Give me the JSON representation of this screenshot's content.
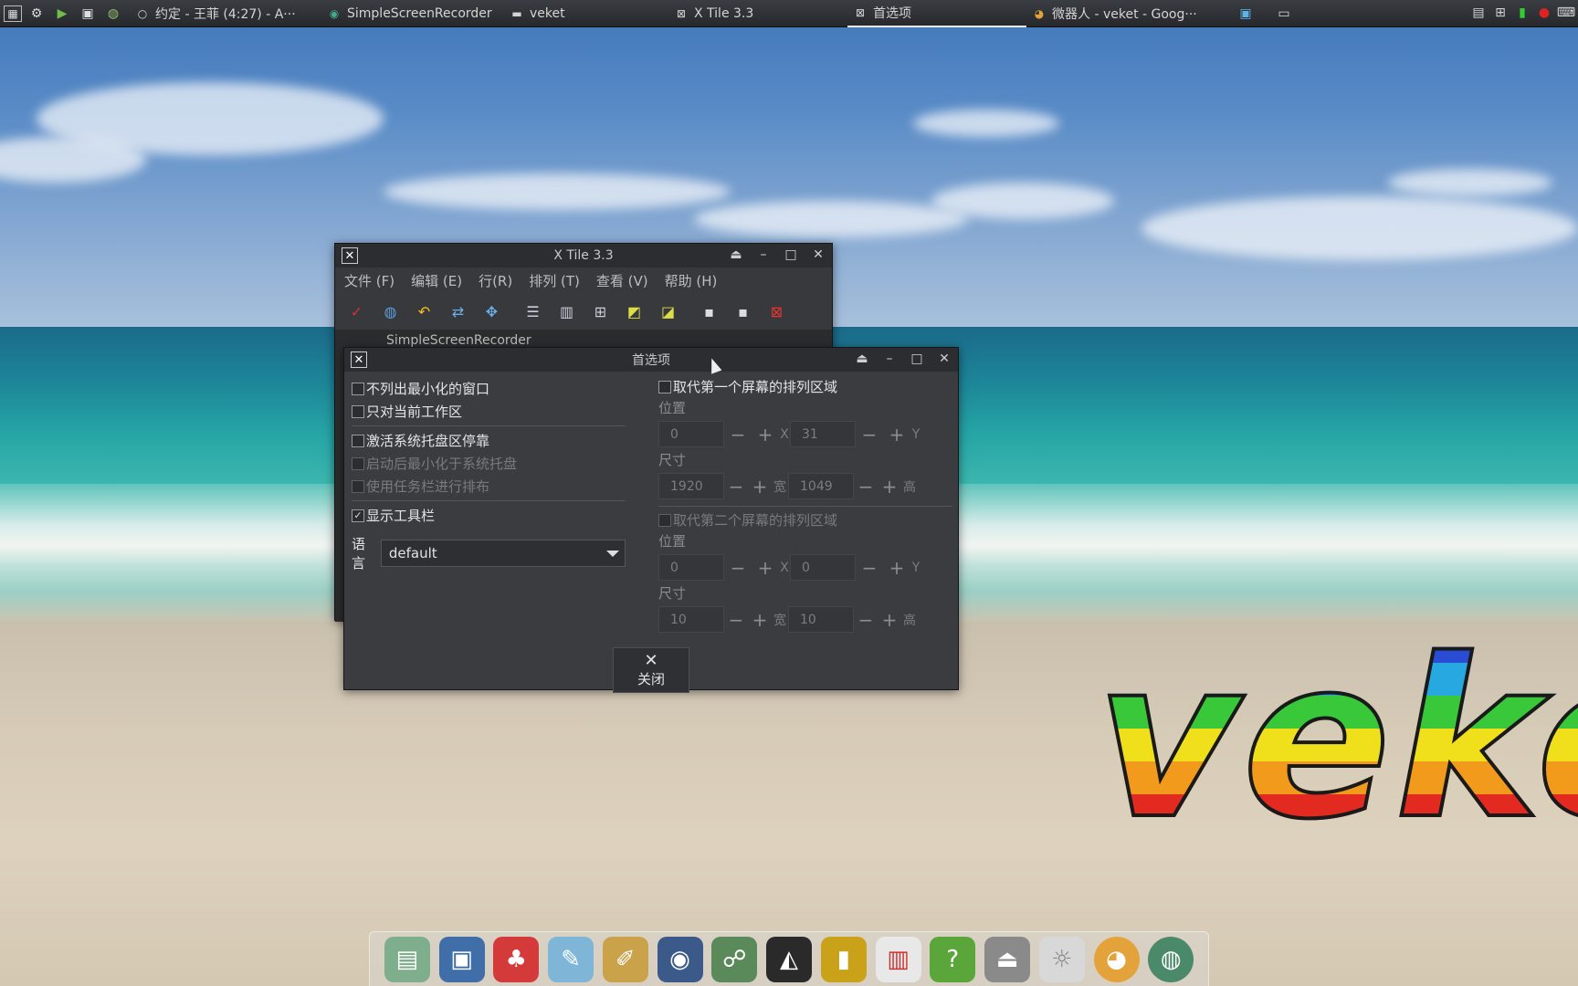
{
  "top_panel": {
    "launchers": [
      {
        "name": "system-monitor",
        "glyph": "▦"
      },
      {
        "name": "settings",
        "glyph": "⚙"
      },
      {
        "name": "media",
        "glyph": "▶"
      },
      {
        "name": "terminal",
        "glyph": "▣"
      },
      {
        "name": "globe",
        "glyph": "◍"
      }
    ],
    "tasks": [
      {
        "label": "约定 - 王菲 (4:27) - A···",
        "icon": "○",
        "active": false
      },
      {
        "label": "SimpleScreenRecorder",
        "icon": "◉",
        "active": false
      },
      {
        "label": "veket",
        "icon": "▬",
        "active": false
      },
      {
        "label": "X Tile 3.3",
        "icon": "⊠",
        "active": false
      },
      {
        "label": "首选项",
        "icon": "⊠",
        "active": true
      },
      {
        "label": "微器人 - veket - Goog···",
        "icon": "◕",
        "active": false
      }
    ]
  },
  "xtile": {
    "title": "X Tile 3.3",
    "menu": [
      "文件 (F)",
      "编辑 (E)",
      "行(R)",
      "排列 (T)",
      "查看 (V)",
      "帮助 (H)"
    ],
    "list_first_row": "SimpleScreenRecorder"
  },
  "prefs": {
    "title": "首选项",
    "options": {
      "no_minimized": "不列出最小化的窗口",
      "current_workspace": "只对当前工作区",
      "tray_dock": "激活系统托盘区停靠",
      "start_minimized": "启动后最小化于系统托盘",
      "use_taskbar": "使用任务栏进行排布",
      "show_toolbar": "显示工具栏"
    },
    "language_label": "语言",
    "language_value": "default",
    "screen1": {
      "override_label": "取代第一个屏幕的排列区域",
      "position_label": "位置",
      "pos_x": "0",
      "pos_y": "31",
      "size_label": "尺寸",
      "width": "1920",
      "height": "1049"
    },
    "screen2": {
      "override_label": "取代第二个屏幕的排列区域",
      "position_label": "位置",
      "pos_x": "0",
      "pos_y": "0",
      "size_label": "尺寸",
      "width": "10",
      "height": "10"
    },
    "axis": {
      "x": "X",
      "y": "Y",
      "w": "宽",
      "h": "高"
    },
    "close_label": "关闭"
  },
  "desktop": {
    "logo_text": "veket"
  }
}
